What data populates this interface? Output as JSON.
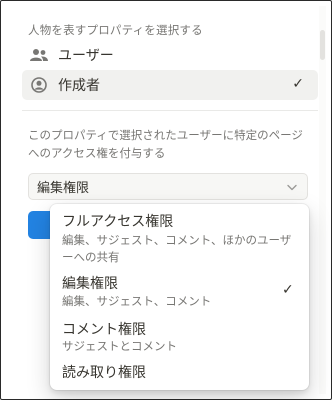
{
  "property_picker": {
    "section_label": "人物を表すプロパティを選択する",
    "options": [
      {
        "label": "ユーザー",
        "icon": "people-icon",
        "selected": false
      },
      {
        "label": "作成者",
        "icon": "user-circle-icon",
        "selected": true,
        "check": "✓"
      }
    ]
  },
  "access": {
    "description": "このプロパティで選択されたユーザーに特定のページへのアクセス権を付与する",
    "select_value": "編集権限",
    "select_icon": "chevron-down-icon"
  },
  "menu": {
    "items": [
      {
        "title": "フルアクセス権限",
        "subtitle": "編集、サジェスト、コメント、ほかのユーザーへの共有"
      },
      {
        "title": "編集権限",
        "subtitle": "編集、サジェスト、コメント",
        "check": "✓"
      },
      {
        "title": "コメント権限",
        "subtitle": "サジェストとコメント"
      },
      {
        "title": "読み取り権限",
        "subtitle": ""
      }
    ]
  },
  "colors": {
    "accent": "#2383e2",
    "text": "#37352f",
    "muted": "#787774",
    "selected_bg": "#f1f1ef"
  }
}
